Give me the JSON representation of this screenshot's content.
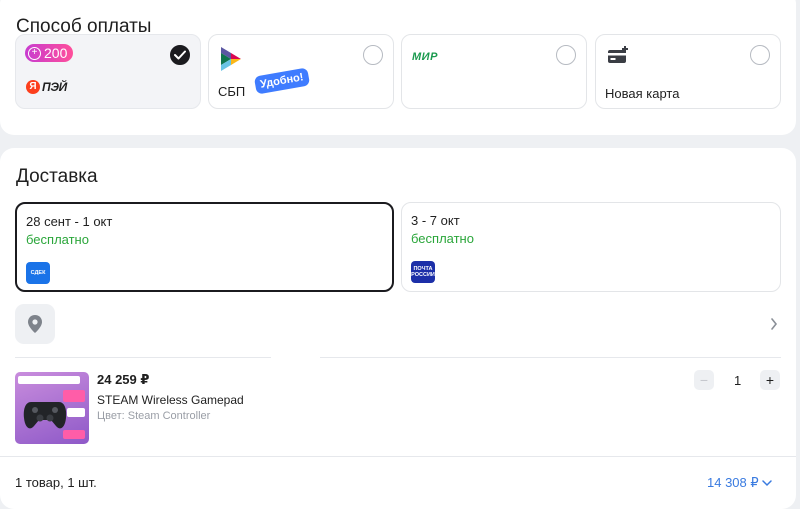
{
  "payment": {
    "title": "Способ оплаты",
    "options": [
      {
        "badge": "200",
        "sub_brand": "ПЭЙ",
        "selected": true,
        "logo_icon": "plus-points-icon"
      },
      {
        "label": "СБП",
        "badge": "Удобно!",
        "selected": false,
        "logo_icon": "sbp-logo-icon"
      },
      {
        "logo_text": "МИР",
        "selected": false,
        "logo_icon": "mir-logo-icon"
      },
      {
        "label": "Новая карта",
        "selected": false,
        "logo_icon": "add-card-icon"
      }
    ]
  },
  "delivery": {
    "title": "Доставка",
    "options": [
      {
        "dates": "28 сент - 1 окт",
        "price": "бесплатно",
        "carrier_logo": "СДЕК",
        "selected": true
      },
      {
        "dates": "3 - 7 окт",
        "price": "бесплатно",
        "carrier_logo": "ПОЧТА РОССИИ",
        "selected": false
      }
    ],
    "address_icon": "location-pin-icon"
  },
  "product": {
    "price": "24 259 ₽",
    "name": "STEAM Wireless Gamepad",
    "color": "Цвет: Steam Controller",
    "quantity": "1",
    "minus": "−",
    "plus": "+"
  },
  "footer": {
    "summary": "1 товар, 1 шт.",
    "total": "14 308 ₽"
  },
  "colors": {
    "accent_green": "#2aa63a",
    "link_blue": "#3a7be0",
    "selected_border": "#1b1b1f"
  }
}
